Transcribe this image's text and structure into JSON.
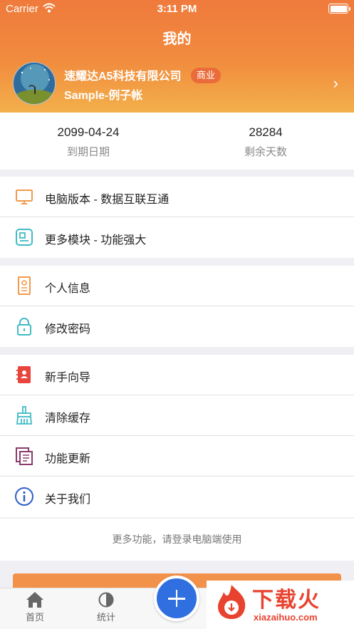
{
  "status_bar": {
    "carrier": "Carrier",
    "time": "3:11 PM"
  },
  "nav": {
    "title": "我的"
  },
  "profile": {
    "company": "速耀达A5科技有限公司",
    "badge": "商业",
    "account": "Sample-例子帐"
  },
  "stats": [
    {
      "value": "2099-04-24",
      "label": "到期日期"
    },
    {
      "value": "28284",
      "label": "剩余天数"
    }
  ],
  "menu_groups": [
    [
      {
        "label": "电脑版本 - 数据互联互通",
        "icon": "monitor-icon",
        "color": "#f29a4a"
      },
      {
        "label": "更多模块 - 功能强大",
        "icon": "module-icon",
        "color": "#3fbcc6"
      }
    ],
    [
      {
        "label": "个人信息",
        "icon": "id-card-icon",
        "color": "#f29a4a"
      },
      {
        "label": "修改密码",
        "icon": "lock-icon",
        "color": "#3fbcc6"
      }
    ],
    [
      {
        "label": "新手向导",
        "icon": "guide-book-icon",
        "color": "#e8453c"
      },
      {
        "label": "清除缓存",
        "icon": "broom-icon",
        "color": "#3fbcc6"
      },
      {
        "label": "功能更新",
        "icon": "update-icon",
        "color": "#8b3a6e"
      },
      {
        "label": "关于我们",
        "icon": "info-icon",
        "color": "#2f5fc9"
      }
    ]
  ],
  "footer_note": "更多功能，请登录电脑端使用",
  "tabbar": [
    {
      "label": "首页",
      "icon": "home-icon"
    },
    {
      "label": "统计",
      "icon": "pie-chart-icon"
    }
  ],
  "watermark": {
    "brand_cn": "下载火",
    "brand_url": "xiazaihuo.com"
  }
}
